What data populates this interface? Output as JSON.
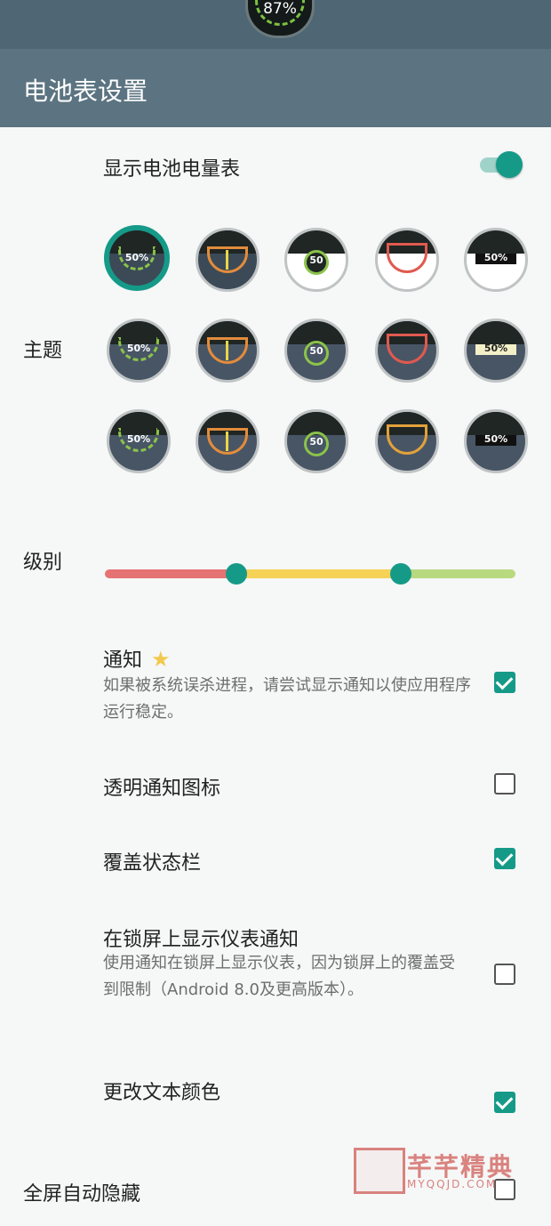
{
  "status_bar": {
    "battery_percent": "87%"
  },
  "app_bar": {
    "title": "电池表设置"
  },
  "show_meter": {
    "label": "显示电池电量表",
    "enabled": true
  },
  "theme": {
    "label": "主题",
    "selected_index": 0,
    "items": [
      {
        "style": "arc-text",
        "text": "50%",
        "bg": "#3b4a56"
      },
      {
        "style": "needle",
        "text": "",
        "bg": "#3b4a56"
      },
      {
        "style": "ring",
        "text": "50",
        "bg": "#ffffff"
      },
      {
        "style": "rainbow",
        "text": "",
        "bg": "#ffffff"
      },
      {
        "style": "bar",
        "text": "50%",
        "bg": "#ffffff"
      },
      {
        "style": "arc-text",
        "text": "50%",
        "bg": "#485565"
      },
      {
        "style": "needle",
        "text": "",
        "bg": "#485565"
      },
      {
        "style": "ring",
        "text": "50",
        "bg": "#485565"
      },
      {
        "style": "rainbow",
        "text": "",
        "bg": "#485565"
      },
      {
        "style": "bar",
        "text": "50%",
        "bg": "#485565"
      },
      {
        "style": "arc-text",
        "text": "50%",
        "bg": "#485565"
      },
      {
        "style": "needle",
        "text": "",
        "bg": "#485565"
      },
      {
        "style": "ring",
        "text": "50",
        "bg": "#485565"
      },
      {
        "style": "rainbow",
        "text": "",
        "bg": "#485565"
      },
      {
        "style": "bar",
        "text": "50%",
        "bg": "#485565"
      }
    ]
  },
  "level": {
    "label": "级别",
    "low_threshold_fraction": 0.32,
    "high_threshold_fraction": 0.72,
    "colors": {
      "low": "#e57373",
      "mid": "#f6d257",
      "high": "#b9d97f",
      "knob": "#159a88"
    }
  },
  "notification": {
    "label": "通知",
    "star_icon": "star-icon",
    "description": "如果被系统误杀进程，请尝试显示通知以使应用程序运行稳定。",
    "checked": true
  },
  "transparent_icon": {
    "label": "透明通知图标",
    "checked": false
  },
  "overlay_statusbar": {
    "label": "覆盖状态栏",
    "checked": true
  },
  "lockscreen": {
    "label": "在锁屏上显示仪表通知",
    "description": "使用通知在锁屏上显示仪表，因为锁屏上的覆盖受到限制（Android 8.0及更高版本）。",
    "checked": false
  },
  "text_color": {
    "label": "更改文本颜色",
    "checked": true
  },
  "fullscreen_hide": {
    "label": "全屏自动隐藏",
    "checked": false
  },
  "watermark": {
    "text": "芊芊精典",
    "url": "MYQQJD.COM"
  },
  "colors": {
    "accent": "#159a88",
    "app_bar": "#5c7481",
    "status_bar": "#4f6674"
  }
}
